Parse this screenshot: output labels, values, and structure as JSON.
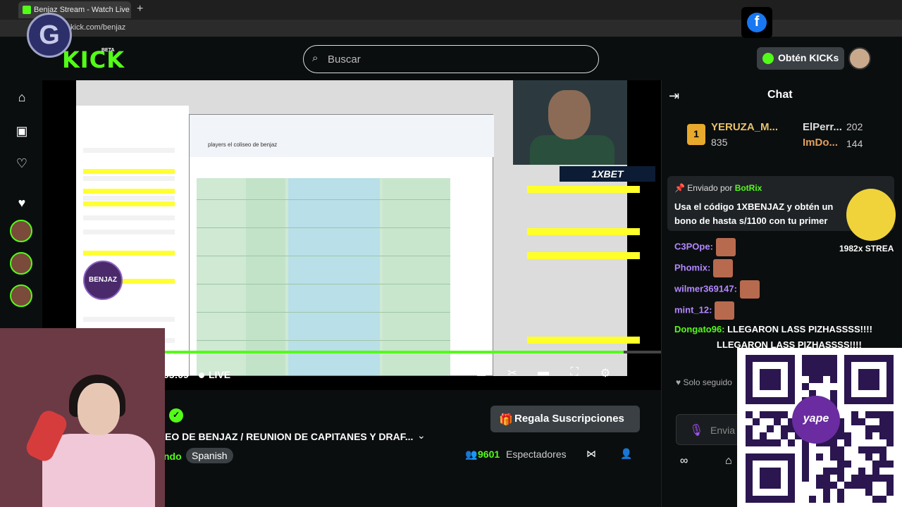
{
  "browser": {
    "tab_title": "Benjaz Stream - Watch Live on Ki",
    "url": "kick.com/benjaz"
  },
  "header": {
    "logo": "KICK",
    "beta": "BETA",
    "search_placeholder": "Buscar",
    "kicks_button": "Obtén KICKs"
  },
  "video": {
    "time": "05:09",
    "live": "LIVE",
    "bet_banner": "1XBET",
    "badge": "BENJAZ",
    "sheet_title": "players el coliseo de benjaz",
    "progress": 0.94
  },
  "info": {
    "gift_button": "Regala Suscripciones",
    "stream_title": "EO DE BENJAZ / REUNION DE CAPITANES Y DRAF...",
    "category_fragment": "ndo",
    "language": "Spanish",
    "viewers_count": "9601",
    "viewers_label": "Espectadores"
  },
  "chat": {
    "title": "Chat",
    "top_gifters": [
      {
        "name": "YERUZA_M...",
        "count": "835"
      },
      {
        "name": "ElPerr...",
        "count": "202"
      },
      {
        "name": "ImDo...",
        "count": "144"
      }
    ],
    "pinned": {
      "label": "Enviado por",
      "bot": "BotRix",
      "message": "Usa el código 1XBENJAZ y obtén un bono de hasta s/1100 con tu primer"
    },
    "streak": "1982x STREA",
    "messages": [
      {
        "user": "C3POpe:",
        "text": "",
        "color": "#b388ff"
      },
      {
        "user": "Phomix:",
        "text": "",
        "color": "#b388ff"
      },
      {
        "user": "wilmer369147:",
        "text": "",
        "color": "#b388ff"
      },
      {
        "user": "mint_12:",
        "text": "",
        "color": "#b388ff"
      },
      {
        "user": "Dongato96:",
        "text": " LLEGARON LASS PIZHASSSS!!!!",
        "color": "#53fc18"
      },
      {
        "user": "",
        "text": "LLEGARON LASS PIZHASSSS!!!!",
        "color": "#ffffff"
      }
    ],
    "followers_only": "Solo seguido",
    "input_placeholder": "Envia"
  },
  "qr": {
    "brand": "yape"
  }
}
